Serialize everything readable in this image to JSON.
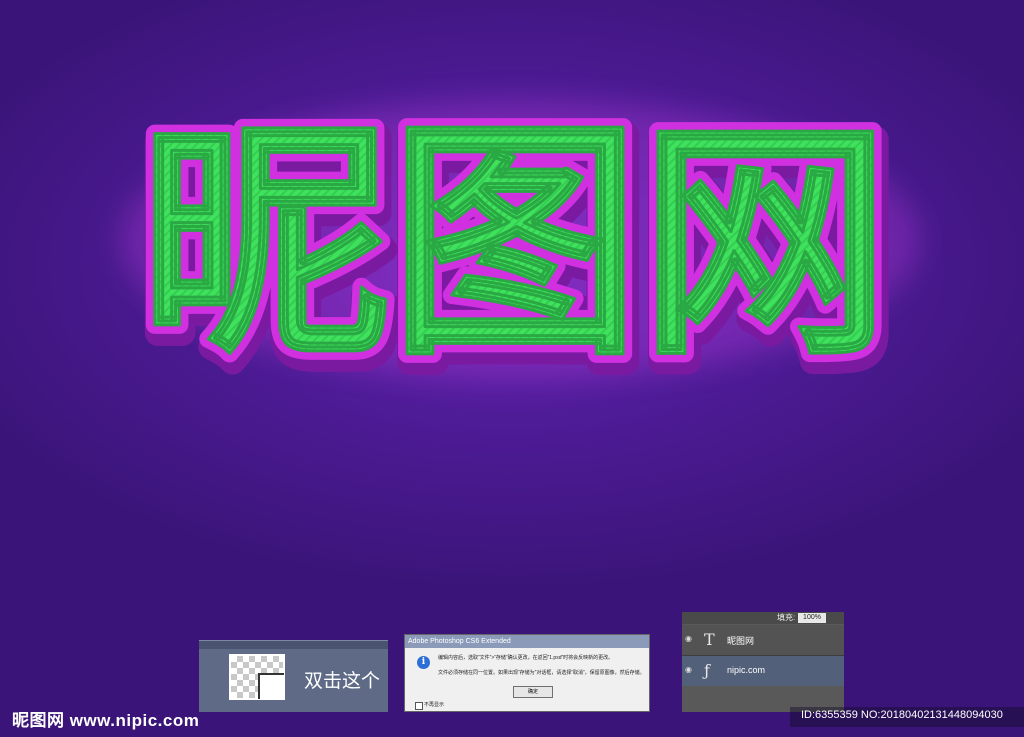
{
  "hero": {
    "title": "昵图网"
  },
  "layer_panel": {
    "label": "双击这个"
  },
  "dialog": {
    "title": "Adobe Photoshop CS6 Extended",
    "message_line1": "编辑内容后，选取“文件”>“存储”确认更改，在返回“1.psd”时将会反映新的更改。",
    "message_line2": "文件必须存储在同一位置。如果出现“存储为”对话框，请选择“取消”，保留原图像，然后存储。",
    "ok_label": "确定",
    "checkbox_label": "不再显示"
  },
  "layers_panel": {
    "fill_label": "填充:",
    "fill_value": "100%",
    "layers": [
      {
        "glyph": "T",
        "name": "昵图网"
      },
      {
        "glyph": "ƒ",
        "name": "nipic.com"
      }
    ]
  },
  "footer": {
    "watermark": "昵图网 www.nipic.com",
    "id_text": "ID:6355359 NO:20180402131448094030"
  },
  "colors": {
    "background": "#4f1c98",
    "text_fill": "#3ee05a",
    "text_outline": "#c020d0"
  }
}
